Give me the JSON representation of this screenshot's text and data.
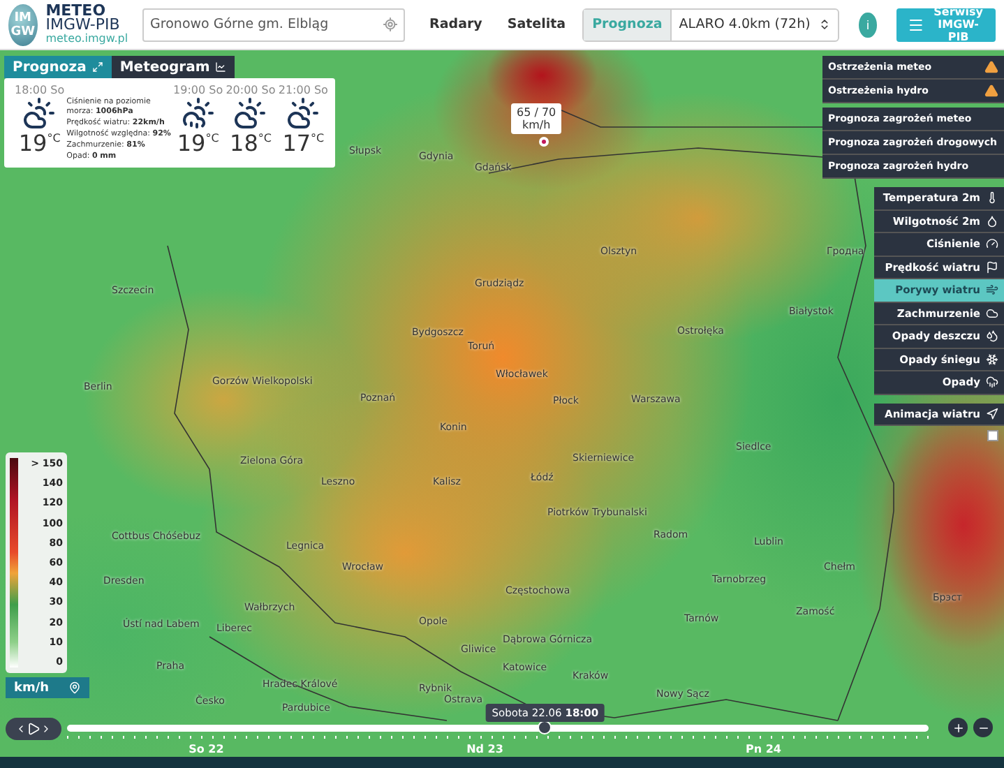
{
  "header": {
    "logo": {
      "top": "IM",
      "bottom": "GW"
    },
    "brand": {
      "title": "METEO",
      "subtitle": "IMGW-PIB",
      "url": "meteo.imgw.pl"
    },
    "search": {
      "value": "Gronowo Górne gm. Elbląg"
    },
    "nav": [
      {
        "label": "Radary",
        "selected": false
      },
      {
        "label": "Satelita",
        "selected": false
      },
      {
        "label": "Prognoza",
        "selected": true
      }
    ],
    "model_select": {
      "value": "ALARO 4.0km (72h)"
    },
    "info_button": "i",
    "services_button": {
      "line_1": "Serwisy",
      "line_2": "IMGW-PIB"
    }
  },
  "forecast_panel": {
    "tabs": [
      {
        "label": "Prognoza",
        "selected": true
      },
      {
        "label": "Meteogram",
        "selected": false
      }
    ],
    "current": {
      "time": "18:00 So",
      "kind": "partly-cloudy",
      "temp": "19",
      "unit": "°C",
      "details": [
        "Ciśnienie na poziomie morza: **1006hPa**",
        "Prędkość wiatru: **22km/h**",
        "Wilgotność względna: **92%**",
        "Zachmurzenie: **81%**",
        "Opad: **0 mm**"
      ]
    },
    "hours": [
      {
        "time": "19:00 So",
        "kind": "showers",
        "temp": "19",
        "unit": "°C"
      },
      {
        "time": "20:00 So",
        "kind": "partly-cloudy",
        "temp": "18",
        "unit": "°C"
      },
      {
        "time": "21:00 So",
        "kind": "partly-cloudy",
        "temp": "17",
        "unit": "°C"
      }
    ]
  },
  "warnings": [
    {
      "label": "Ostrzeżenia meteo"
    },
    {
      "label": "Ostrzeżenia hydro"
    }
  ],
  "hazard_forecasts": [
    "Prognoza zagrożeń meteo",
    "Prognoza zagrożeń drogowych",
    "Prognoza zagrożeń hydro"
  ],
  "layers": [
    {
      "label": "Temperatura 2m",
      "kind": "temperature",
      "selected": false
    },
    {
      "label": "Wilgotność 2m",
      "kind": "humidity",
      "selected": false
    },
    {
      "label": "Ciśnienie",
      "kind": "pressure",
      "selected": false
    },
    {
      "label": "Prędkość wiatru",
      "kind": "wind-speed",
      "selected": false
    },
    {
      "label": "Porywy wiatru",
      "kind": "gusts",
      "selected": true
    },
    {
      "label": "Zachmurzenie",
      "kind": "clouds",
      "selected": false
    },
    {
      "label": "Opady deszczu",
      "kind": "rain",
      "selected": false
    },
    {
      "label": "Opady śniegu",
      "kind": "snow",
      "selected": false
    },
    {
      "label": "Opady",
      "kind": "precipitation",
      "selected": false
    }
  ],
  "wind_animation": {
    "label": "Animacja wiatru",
    "checked": false
  },
  "legend": {
    "labels": [
      "> 150",
      "140",
      "120",
      "100",
      "80",
      "60",
      "40",
      "30",
      "20",
      "10",
      "0"
    ],
    "unit": "km/h"
  },
  "popup": {
    "value": "65 / 70",
    "unit": "km/h"
  },
  "map_labels": [
    "Słupsk",
    "Gdynia",
    "Gdańsk",
    "Olsztyn",
    "Гродна",
    "Szczecin",
    "Grudziądz",
    "Bydgoszcz",
    "Toruń",
    "Białystok",
    "Ostrołęka",
    "Gorzów Wielkopolski",
    "Berlin",
    "Włocławek",
    "Poznań",
    "Płock",
    "Warszawa",
    "Konin",
    "Siedlce",
    "Skierniewice",
    "Łódź",
    "Zielona Góra",
    "Leszno",
    "Kalisz",
    "Piotrków Trybunalski",
    "Radom",
    "Cottbus Chóśebuz",
    "Legnica",
    "Lublin",
    "Wrocław",
    "Dresden",
    "Брэст",
    "Chełm",
    "Wałbrzych",
    "Częstochowa",
    "Opole",
    "Zamość",
    "Tarnobrzeg",
    "Ústí nad Labem",
    "Liberec",
    "Tarnów",
    "Dąbrowa Górnicza",
    "Gliwice",
    "Praha",
    "Katowice",
    "Kraków",
    "Hradec Králové",
    "Rybnik",
    "Česko",
    "Ostrava",
    "Nowy Sącz",
    "Pardubice"
  ],
  "timeline": {
    "tooltip": "Sobota 22.06 **18:00**",
    "level": 0.555,
    "days": [
      "So 22",
      "Nd 23",
      "Pn 24"
    ]
  }
}
